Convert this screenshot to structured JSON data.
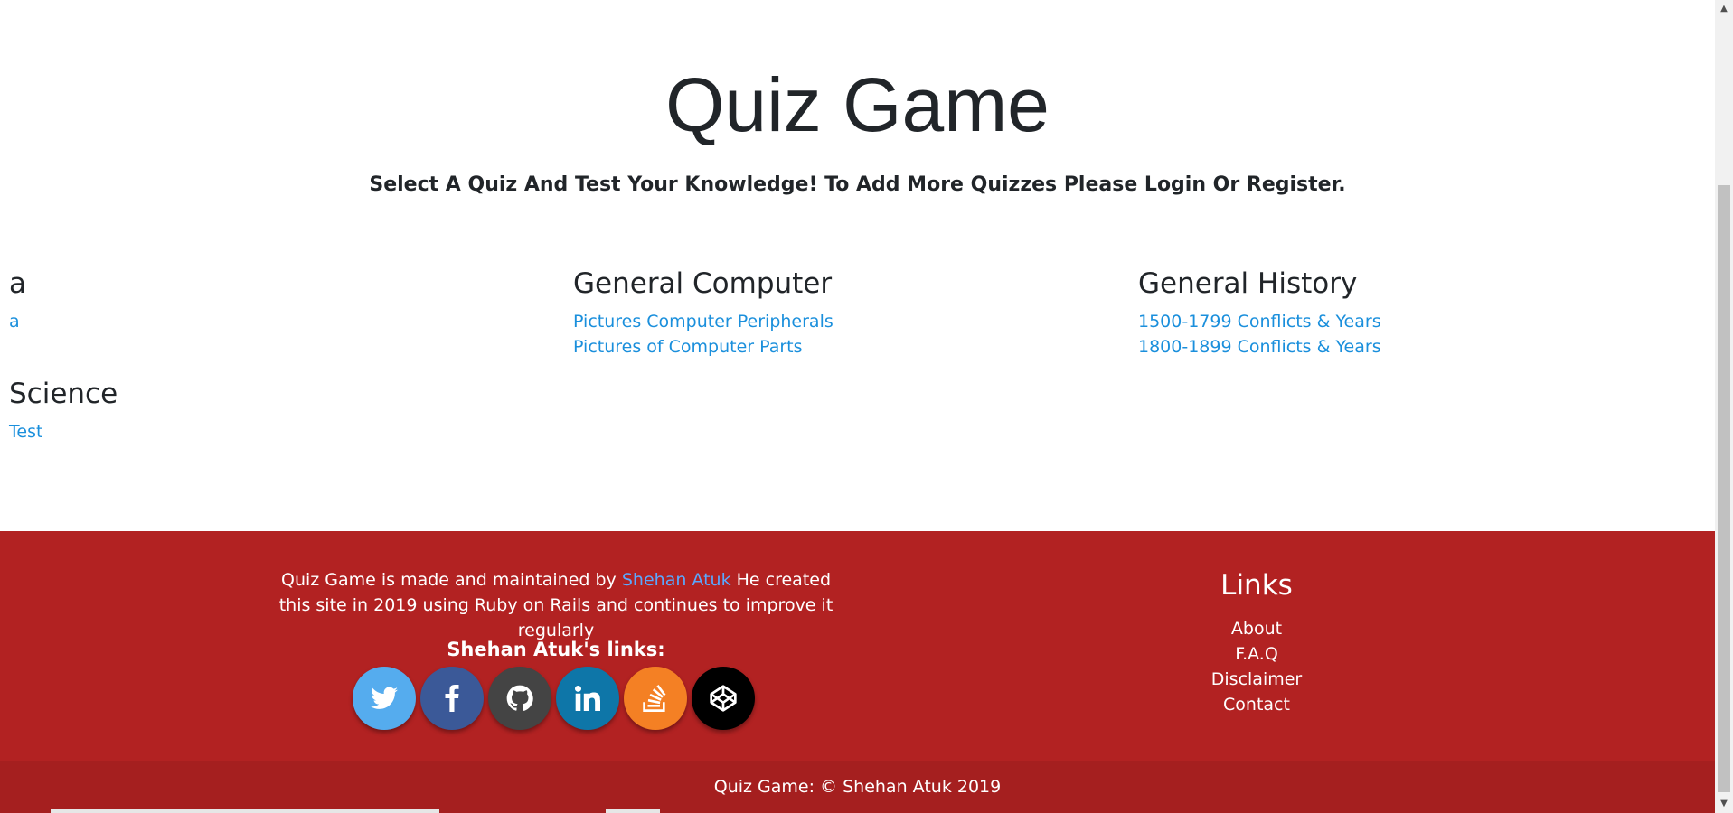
{
  "header": {
    "title": "Quiz Game",
    "subtitle": "Select A Quiz And Test Your Knowledge! To Add More Quizzes Please Login Or Register."
  },
  "categories": [
    {
      "name": "a",
      "quizzes": [
        "a"
      ]
    },
    {
      "name": "General Computer",
      "quizzes": [
        "Pictures Computer Peripherals",
        "Pictures of Computer Parts"
      ]
    },
    {
      "name": "General History",
      "quizzes": [
        "1500-1799 Conflicts & Years",
        "1800-1899 Conflicts & Years"
      ]
    },
    {
      "name": "Science",
      "quizzes": [
        "Test"
      ]
    }
  ],
  "footer": {
    "about_prefix": "Quiz Game is made and maintained by",
    "author_link": "Shehan Atuk",
    "about_suffix": "He created this site in 2019 using Ruby on Rails and continues to improve it regularly",
    "social_heading": "Shehan Atuk's links:",
    "socials": [
      {
        "name": "twitter-icon",
        "color": "#55acee"
      },
      {
        "name": "facebook-icon",
        "color": "#3b5998"
      },
      {
        "name": "github-icon",
        "color": "#444444"
      },
      {
        "name": "linkedin-icon",
        "color": "#0e76a8"
      },
      {
        "name": "stackoverflow-icon",
        "color": "#f48024"
      },
      {
        "name": "codepen-icon",
        "color": "#000000"
      }
    ],
    "links_heading": "Links",
    "links": [
      "About",
      "F.A.Q",
      "Disclaimer",
      "Contact"
    ],
    "copyright": "Quiz Game: © Shehan Atuk 2019"
  },
  "colors": {
    "footer_bg": "#b22222",
    "copyright_bg": "#a51f1f",
    "link": "#1a8fdc",
    "author_link": "#5aa8ff"
  }
}
